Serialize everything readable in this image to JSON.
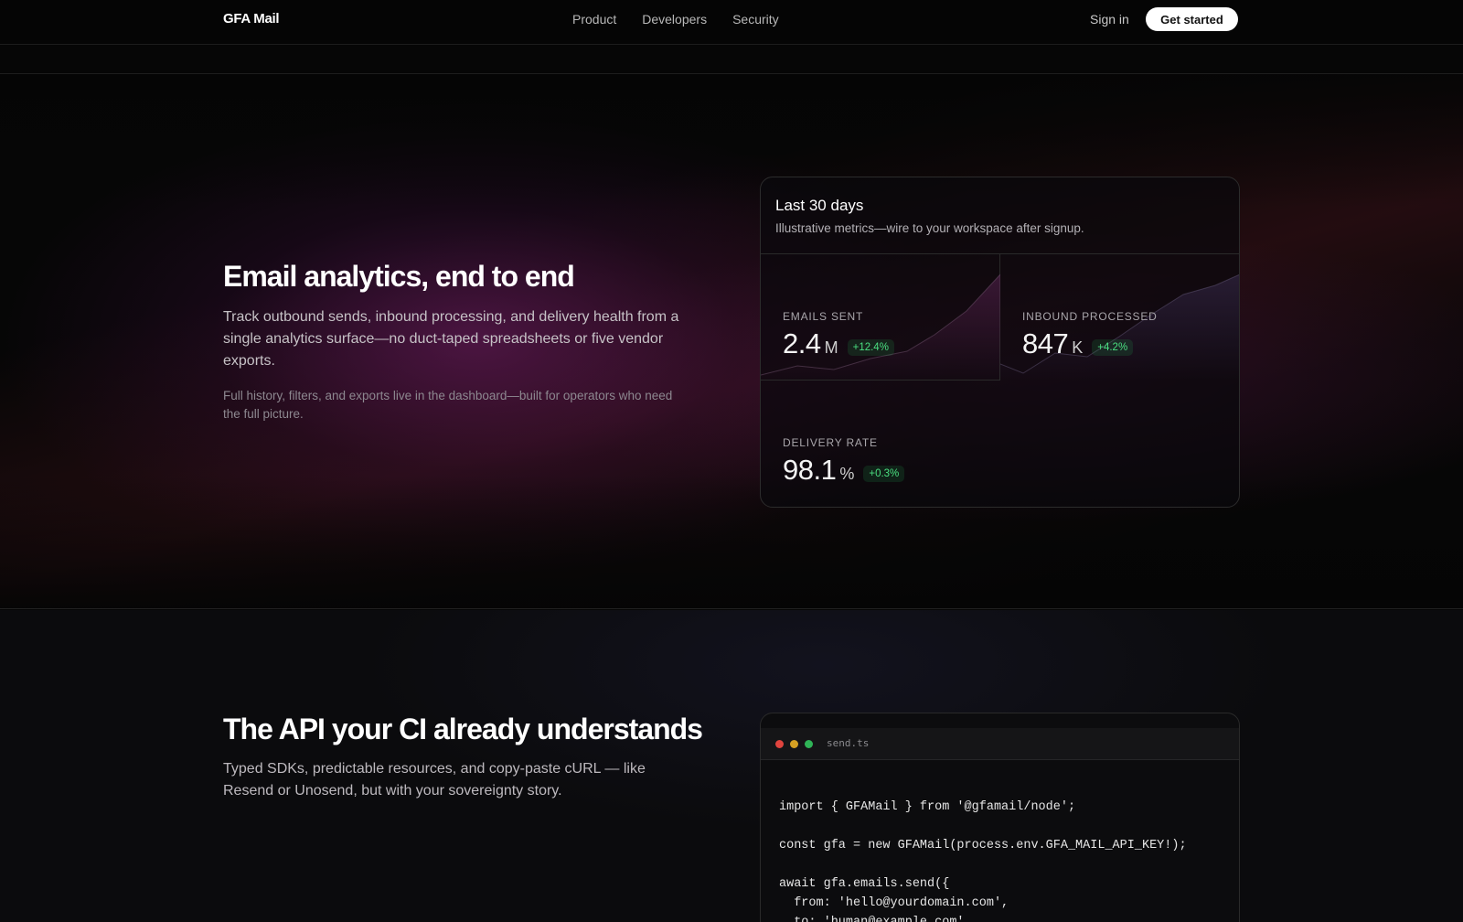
{
  "nav": {
    "logo": "GFA Mail",
    "links": [
      "Product",
      "Developers",
      "Security"
    ],
    "signin": "Sign in",
    "cta": "Get started"
  },
  "hero": {
    "title": "Email analytics, end to end",
    "lead": "Track outbound sends, inbound processing, and delivery health from a single analytics surface—no duct-taped spreadsheets or five vendor exports.",
    "sub": "Full history, filters, and exports live in the dashboard—built for operators who need the full picture."
  },
  "metrics_card": {
    "title": "Last 30 days",
    "description": "Illustrative metrics—wire to your workspace after signup.",
    "metrics": [
      {
        "label": "EMAILS SENT",
        "value": "2.4",
        "unit": "M",
        "delta": "+12.4%"
      },
      {
        "label": "INBOUND PROCESSED",
        "value": "847",
        "unit": "K",
        "delta": "+4.2%"
      },
      {
        "label": "DELIVERY RATE",
        "value": "98.1",
        "unit": "%",
        "delta": "+0.3%"
      }
    ]
  },
  "api": {
    "title": "The API your CI already understands",
    "lead": "Typed SDKs, predictable resources, and copy-paste cURL — like Resend or Unosend, but with your sovereignty story.",
    "filename": "send.ts",
    "code": "import { GFAMail } from '@gfamail/node';\n\nconst gfa = new GFAMail(process.env.GFA_MAIL_API_KEY!);\n\nawait gfa.emails.send({\n  from: 'hello@yourdomain.com',\n  to: 'human@example.com',"
  },
  "colors": {
    "accent_positive": "#4ade80",
    "window_dot_red": "#e0443e",
    "window_dot_yellow": "#d6a123",
    "window_dot_green": "#2fb457"
  }
}
